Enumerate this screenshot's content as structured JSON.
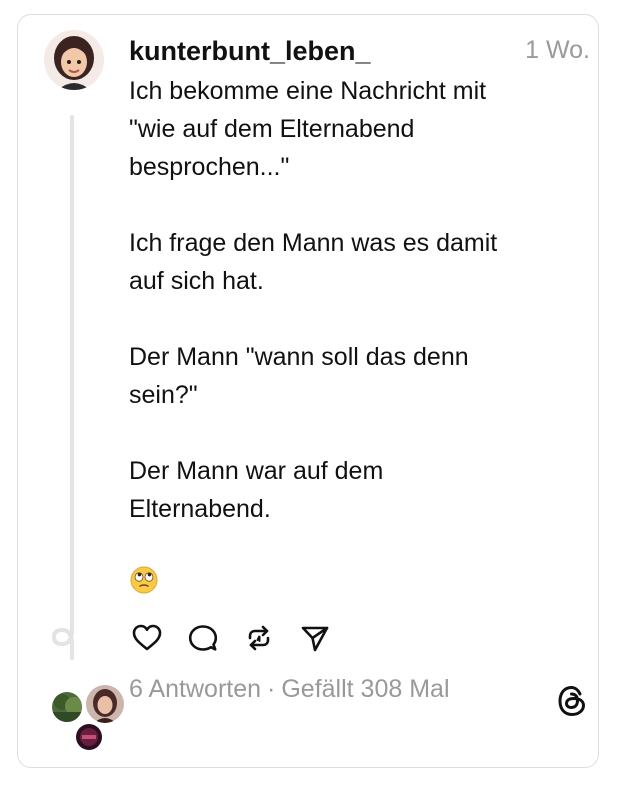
{
  "post": {
    "username": "kunterbunt_leben_",
    "time": "1 Wo.",
    "paragraphs": [
      [
        "Ich bekomme eine Nachricht mit",
        "\"wie auf dem Elternabend",
        "besprochen...\""
      ],
      [
        "Ich frage den Mann was es damit",
        "auf sich hat."
      ],
      [
        "Der Mann \"wann soll das denn",
        "sein?\""
      ],
      [
        "Der Mann war auf dem",
        "Elternabend."
      ]
    ],
    "emoji": "face-with-rolling-eyes"
  },
  "actions": [
    {
      "name": "like",
      "icon": "heart-icon"
    },
    {
      "name": "reply",
      "icon": "comment-icon"
    },
    {
      "name": "repost",
      "icon": "repost-icon"
    },
    {
      "name": "share",
      "icon": "send-icon"
    }
  ],
  "stats": {
    "replies": "6 Antworten",
    "separator": "·",
    "likes": "Gefällt 308 Mal"
  },
  "colors": {
    "text": "#111111",
    "muted": "#999999",
    "border": "#dedede",
    "thread_line": "#e3e3e3"
  },
  "brand": {
    "icon": "threads-logo-icon"
  }
}
